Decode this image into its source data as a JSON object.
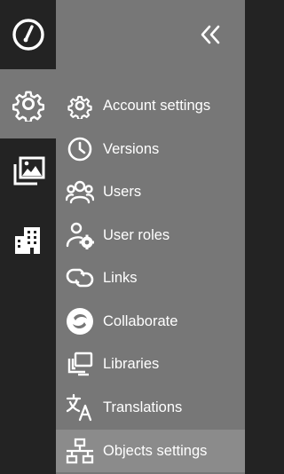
{
  "rail": {
    "items": [
      {
        "icon": "dashboard-gauge-icon",
        "active": false
      },
      {
        "icon": "gear-icon",
        "active": true
      },
      {
        "icon": "image-gallery-icon",
        "active": false
      },
      {
        "icon": "building-icon",
        "active": false
      }
    ]
  },
  "panel": {
    "collapse_icon": "double-chevron-left-icon",
    "items": [
      {
        "label": "Account settings",
        "icon": "gear-icon"
      },
      {
        "label": "Versions",
        "icon": "clock-icon"
      },
      {
        "label": "Users",
        "icon": "users-icon"
      },
      {
        "label": "User roles",
        "icon": "user-gear-icon"
      },
      {
        "label": "Links",
        "icon": "link-icon"
      },
      {
        "label": "Collaborate",
        "icon": "collaborate-icon"
      },
      {
        "label": "Libraries",
        "icon": "libraries-icon"
      },
      {
        "label": "Translations",
        "icon": "translate-icon"
      },
      {
        "label": "Objects settings",
        "icon": "sitemap-icon",
        "selected": true
      }
    ]
  },
  "colors": {
    "rail_bg": "#232323",
    "panel_bg": "#777777",
    "selected_bg": "#8b8b8b",
    "text": "#ffffff"
  }
}
